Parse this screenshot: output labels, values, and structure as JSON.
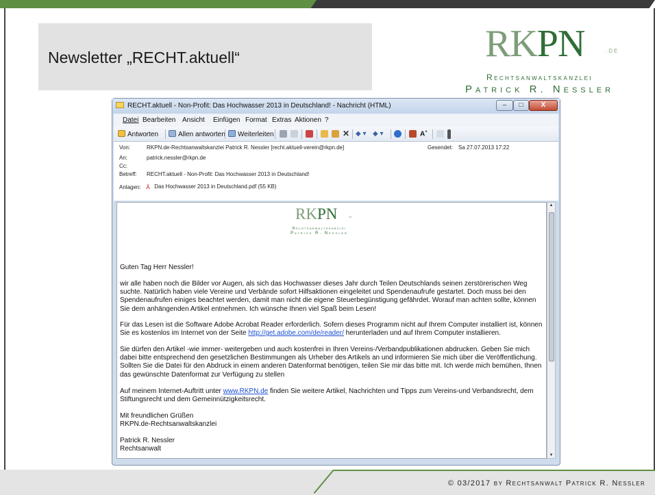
{
  "slide": {
    "title": "Newsletter „RECHT.aktuell“",
    "logo": {
      "rk": "RK",
      "pn": "PN",
      "de": ".DE",
      "line1": "Rechtsanwaltskanzlei",
      "line2": "Patrick R. Nessler"
    },
    "footer": "© 03/2017 by Rechtsanwalt Patrick R. Nessler"
  },
  "window": {
    "title": "RECHT.aktuell - Non-Profit: Das Hochwasser 2013 in Deutschland! - Nachricht (HTML)",
    "buttons": {
      "minimize": "–",
      "maximize": "□",
      "close": "X"
    },
    "menu": [
      "Datei",
      "Bearbeiten",
      "Ansicht",
      "Einfügen",
      "Format",
      "Extras",
      "Aktionen",
      "?"
    ],
    "toolbar": {
      "reply": "Antworten",
      "reply_all": "Allen antworten",
      "forward": "Weiterleiten"
    },
    "header": {
      "from_label": "Von:",
      "from": "RKPN.de-Rechtsanwaltskanzlei Patrick R. Nessler [recht.aktuell-verein@rkpn.de]",
      "sent_label": "Gesendet:",
      "sent": "Sa 27.07.2013 17:22",
      "to_label": "An:",
      "to": "patrick.nessler@rkpn.de",
      "cc_label": "Cc:",
      "subject_label": "Betreff:",
      "subject": "RECHT.aktuell - Non-Profit: Das Hochwasser 2013 in Deutschland!",
      "attach_label": "Anlagen:",
      "attachment": "Das Hochwasser 2013 in Deutschland.pdf (55 KB)"
    },
    "body": {
      "logo": {
        "rk": "RK",
        "pn": "PN",
        "de": ".de",
        "line1": "Rechtsanwaltskanzlei",
        "line2": "Patrick R. Nessler"
      },
      "greeting": "Guten Tag Herr Nessler!",
      "p1": "wir alle haben noch die Bilder vor Augen, als sich das Hochwasser dieses Jahr durch Teilen Deutschlands seinen zerstörerischen Weg suchte. Natürlich haben viele Vereine und Verbände sofort Hilfsaktionen eingeleitet und Spendenaufrufe gestartet. Doch muss bei den Spendenaufrufen einiges beachtet werden, damit man nicht die eigene Steuerbegünstigung gefährdet. Worauf man achten sollte, können Sie dem anhängenden Artikel entnehmen. Ich wünsche Ihnen viel Spaß beim Lesen!",
      "p2a": "Für das Lesen ist die Software Adobe Acrobat Reader erforderlich. Sofern dieses Programm nicht auf Ihrem Computer installiert ist, können Sie es kostenlos im Internet von der Seite ",
      "p2link": "http://get.adobe.com/de/reader/",
      "p2b": " herunterladen und auf Ihrem Computer installieren.",
      "p3": "Sie dürfen den Artikel -wie immer- weitergeben und auch kostenfrei in Ihren Vereins-/Verbandpublikationen abdrucken. Geben Sie mich dabei bitte entsprechend den gesetzlichen Bestimmungen als Urheber des Artikels an und informieren Sie mich über die Veröffentlichung. Sollten Sie die Datei für den Abdruck in einem anderen Datenformat benötigen, teilen Sie mir das bitte mit. Ich werde mich bemühen, Ihnen das gewünschte Datenformat zur Verfügung zu stellen",
      "p4a": "Auf meinem Internet-Auftritt unter ",
      "p4link": "www.RKPN.de",
      "p4b": " finden Sie weitere Artikel, Nachrichten und Tipps zum Vereins-und Verbandsrecht, dem Stiftungsrecht und dem Gemeinnützigkeitsrecht.",
      "closing1": "Mit freundlichen Grüßen",
      "closing2": "RKPN.de-Rechtsanwaltskanzlei",
      "sig1": "Patrick R. Nessler",
      "sig2": "Rechtsanwalt"
    }
  }
}
